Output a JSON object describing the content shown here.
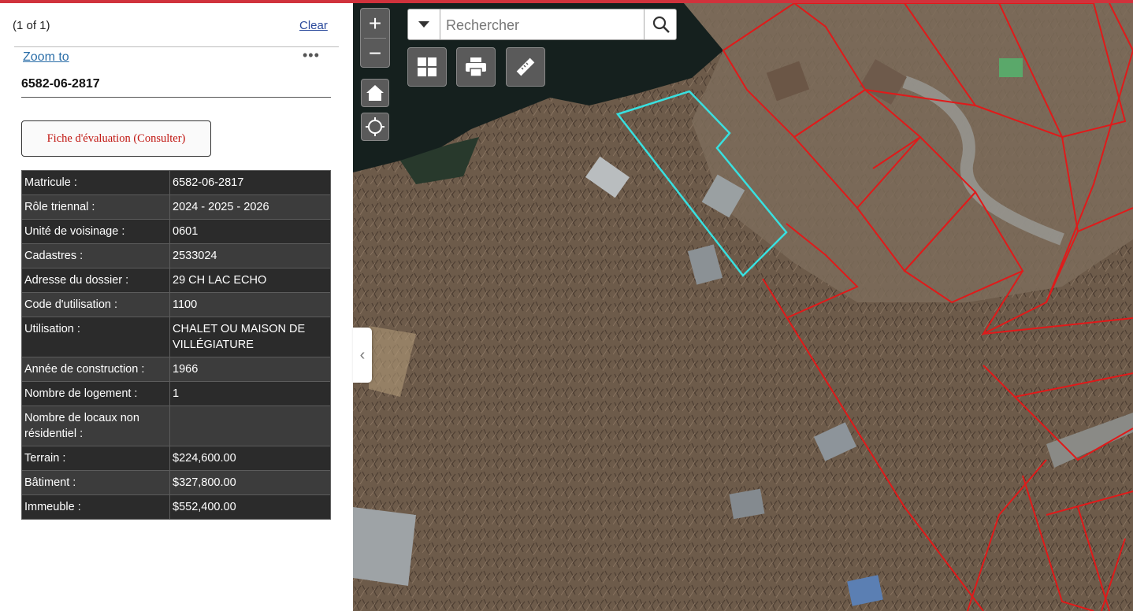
{
  "panel": {
    "pager": "(1 of 1)",
    "clear_label": "Clear",
    "zoom_label": "Zoom to",
    "more_label": "•••",
    "feature_title": "6582-06-2817",
    "fiche_label": "Fiche d'évaluation (Consulter)",
    "collapse_label": "‹",
    "attributes": [
      {
        "label": "Matricule :",
        "value": "6582-06-2817"
      },
      {
        "label": "Rôle triennal :",
        "value": "2024 - 2025 - 2026"
      },
      {
        "label": "Unité de voisinage :",
        "value": "0601"
      },
      {
        "label": "Cadastres :",
        "value": "2533024"
      },
      {
        "label": "Adresse du dossier :",
        "value": "29 CH LAC ECHO"
      },
      {
        "label": "Code d'utilisation :",
        "value": "1100"
      },
      {
        "label": "Utilisation :",
        "value": "CHALET OU MAISON DE VILLÉGIATURE"
      },
      {
        "label": "Année de construction :",
        "value": "1966"
      },
      {
        "label": "Nombre de logement :",
        "value": "1"
      },
      {
        "label": "Nombre de locaux non résidentiel :",
        "value": ""
      },
      {
        "label": "Terrain :",
        "value": "$224,600.00"
      },
      {
        "label": "Bâtiment :",
        "value": "$327,800.00"
      },
      {
        "label": "Immeuble :",
        "value": "$552,400.00"
      }
    ]
  },
  "map": {
    "search_placeholder": "Rechercher",
    "zoom_in_label": "+",
    "zoom_out_label": "−",
    "icons": [
      "chevron-down-icon",
      "search-icon",
      "basemap-grid-icon",
      "print-icon",
      "measure-ruler-icon",
      "home-icon",
      "locate-icon"
    ],
    "colors": {
      "parcel_outline": "#e01a1a",
      "selected_parcel": "#38e0e0",
      "accent_bar": "#d0323c"
    }
  }
}
